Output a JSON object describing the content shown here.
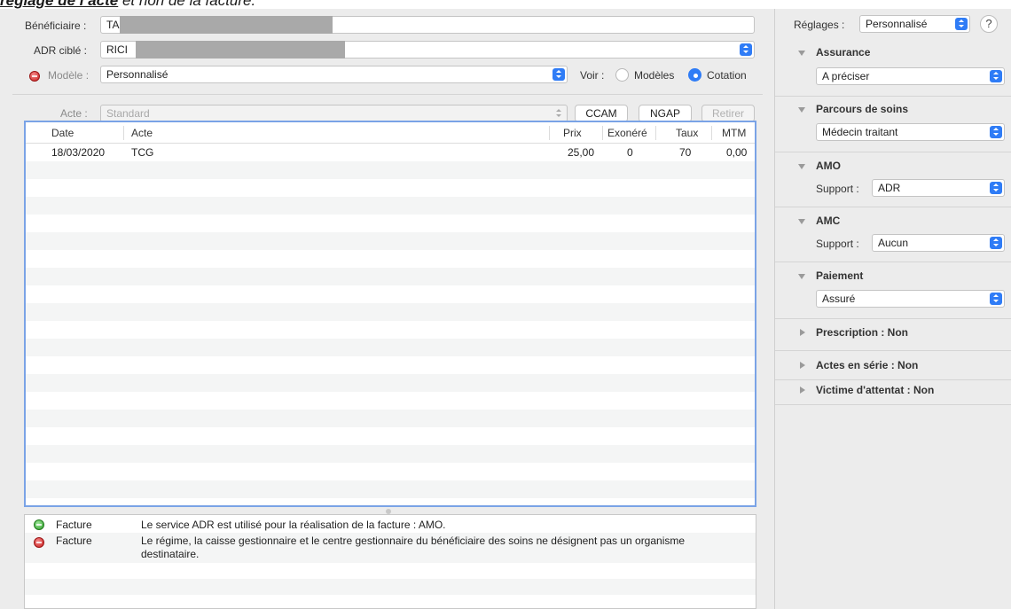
{
  "doc_title": {
    "bold": "réglage de l’acte",
    "rest": " et non de la facture."
  },
  "form": {
    "beneficiaire_label": "Bénéficiaire :",
    "beneficiaire_value": "TA",
    "adr_label": "ADR ciblé :",
    "adr_value": "RICI",
    "modele_label": "Modèle :",
    "modele_value": "Personnalisé",
    "voir_label": "Voir :",
    "radio_modeles": "Modèles",
    "radio_cotation": "Cotation",
    "acte_label": "Acte :",
    "acte_value": "Standard",
    "btn_ccam": "CCAM",
    "btn_ngap": "NGAP",
    "btn_retirer": "Retirer"
  },
  "table": {
    "headers": [
      "Date",
      "Acte",
      "Prix",
      "Exonéré",
      "Taux",
      "MTM"
    ],
    "rows": [
      {
        "date": "18/03/2020",
        "acte": "TCG",
        "prix": "25,00",
        "exonere": "0",
        "taux": "70",
        "mtm": "0,00"
      }
    ]
  },
  "messages": [
    {
      "status": "green",
      "type": "Facture",
      "text": "Le service ADR est utilisé pour la réalisation de la facture : AMO."
    },
    {
      "status": "red",
      "type": "Facture",
      "text": "Le régime, la caisse gestionnaire et le centre gestionnaire du bénéficiaire des soins ne désignent pas un organisme destinataire."
    }
  ],
  "sidebar": {
    "reglages_label": "Réglages :",
    "reglages_value": "Personnalisé",
    "help": "?",
    "assurance_title": "Assurance",
    "assurance_value": "A préciser",
    "parcours_title": "Parcours de soins",
    "parcours_value": "Médecin traitant",
    "amo_title": "AMO",
    "amo_support_label": "Support :",
    "amo_support_value": "ADR",
    "amc_title": "AMC",
    "amc_support_label": "Support :",
    "amc_support_value": "Aucun",
    "paiement_title": "Paiement",
    "paiement_value": "Assuré",
    "prescription": "Prescription : Non",
    "actes_serie": "Actes en série : Non",
    "victime": "Victime d'attentat : Non"
  },
  "colors": {
    "accent": "#2f7cf6",
    "table_border": "#7aa3e6",
    "error": "#c81e1e",
    "ok": "#2e9c2a"
  }
}
